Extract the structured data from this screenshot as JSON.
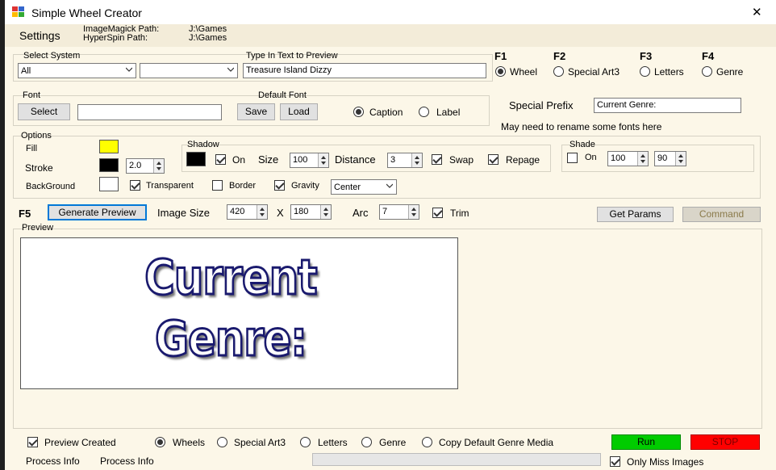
{
  "window": {
    "title": "Simple Wheel Creator",
    "close_glyph": "✕"
  },
  "menu": {
    "settings": "Settings"
  },
  "paths": {
    "imagemagick_label": "ImageMagick Path:",
    "imagemagick_value": "J:\\Games",
    "hyperspin_label": "HyperSpin Path:",
    "hyperspin_value": "J:\\Games"
  },
  "system": {
    "label": "Select System",
    "selected": "All",
    "second_selected": "",
    "text_label": "Type In Text to Preview",
    "text_value": "Treasure Island Dizzy"
  },
  "modes": {
    "f1": "F1",
    "f2": "F2",
    "f3": "F3",
    "f4": "F4",
    "wheel": "Wheel",
    "special_art3": "Special Art3",
    "letters": "Letters",
    "genre": "Genre",
    "selected": "Wheel"
  },
  "font": {
    "label": "Font",
    "select_btn": "Select",
    "value": "",
    "default_label": "Default Font",
    "save_btn": "Save",
    "load_btn": "Load",
    "caption": "Caption",
    "label_opt": "Label",
    "selected": "Caption"
  },
  "special": {
    "prefix_label": "Special Prefix",
    "prefix_value": "Current Genre:",
    "note": "May need to rename some fonts here"
  },
  "options": {
    "label": "Options",
    "fill": "Fill",
    "fill_color": "#ffff00",
    "stroke": "Stroke",
    "stroke_color": "#000000",
    "stroke_width": "2.0",
    "background": "BackGround",
    "background_color": "#ffffff",
    "transparent": "Transparent",
    "transparent_checked": true,
    "border": "Border",
    "border_checked": false,
    "gravity": "Gravity",
    "gravity_checked": true,
    "gravity_value": "Center"
  },
  "shadow": {
    "label": "Shadow",
    "color": "#000000",
    "on": "On",
    "on_checked": true,
    "size_label": "Size",
    "size": "100",
    "distance_label": "Distance",
    "distance": "3",
    "swap": "Swap",
    "swap_checked": true,
    "repage": "Repage",
    "repage_checked": true
  },
  "shade": {
    "label": "Shade",
    "on": "On",
    "on_checked": false,
    "v1": "100",
    "v2": "90"
  },
  "generate": {
    "f5": "F5",
    "button": "Generate  Preview",
    "image_size_label": "Image Size",
    "width": "420",
    "x": "X",
    "height": "180",
    "arc_label": "Arc",
    "arc": "7",
    "trim": "Trim",
    "trim_checked": true,
    "get_params": "Get Params",
    "command": "Command"
  },
  "preview": {
    "label": "Preview",
    "line1": "Current",
    "line2": "Genre:"
  },
  "bottom": {
    "preview_created": "Preview Created",
    "preview_created_checked": true,
    "wheels": "Wheels",
    "special_art3": "Special Art3",
    "letters": "Letters",
    "genre": "Genre",
    "copy_default": "Copy Default Genre Media",
    "selected": "Wheels",
    "run": "Run",
    "stop": "STOP",
    "process_info1": "Process Info",
    "process_info2": "Process Info",
    "only_miss": "Only Miss Images",
    "only_miss_checked": true,
    "run_color": "#00cc00",
    "stop_color": "#ff0000"
  }
}
